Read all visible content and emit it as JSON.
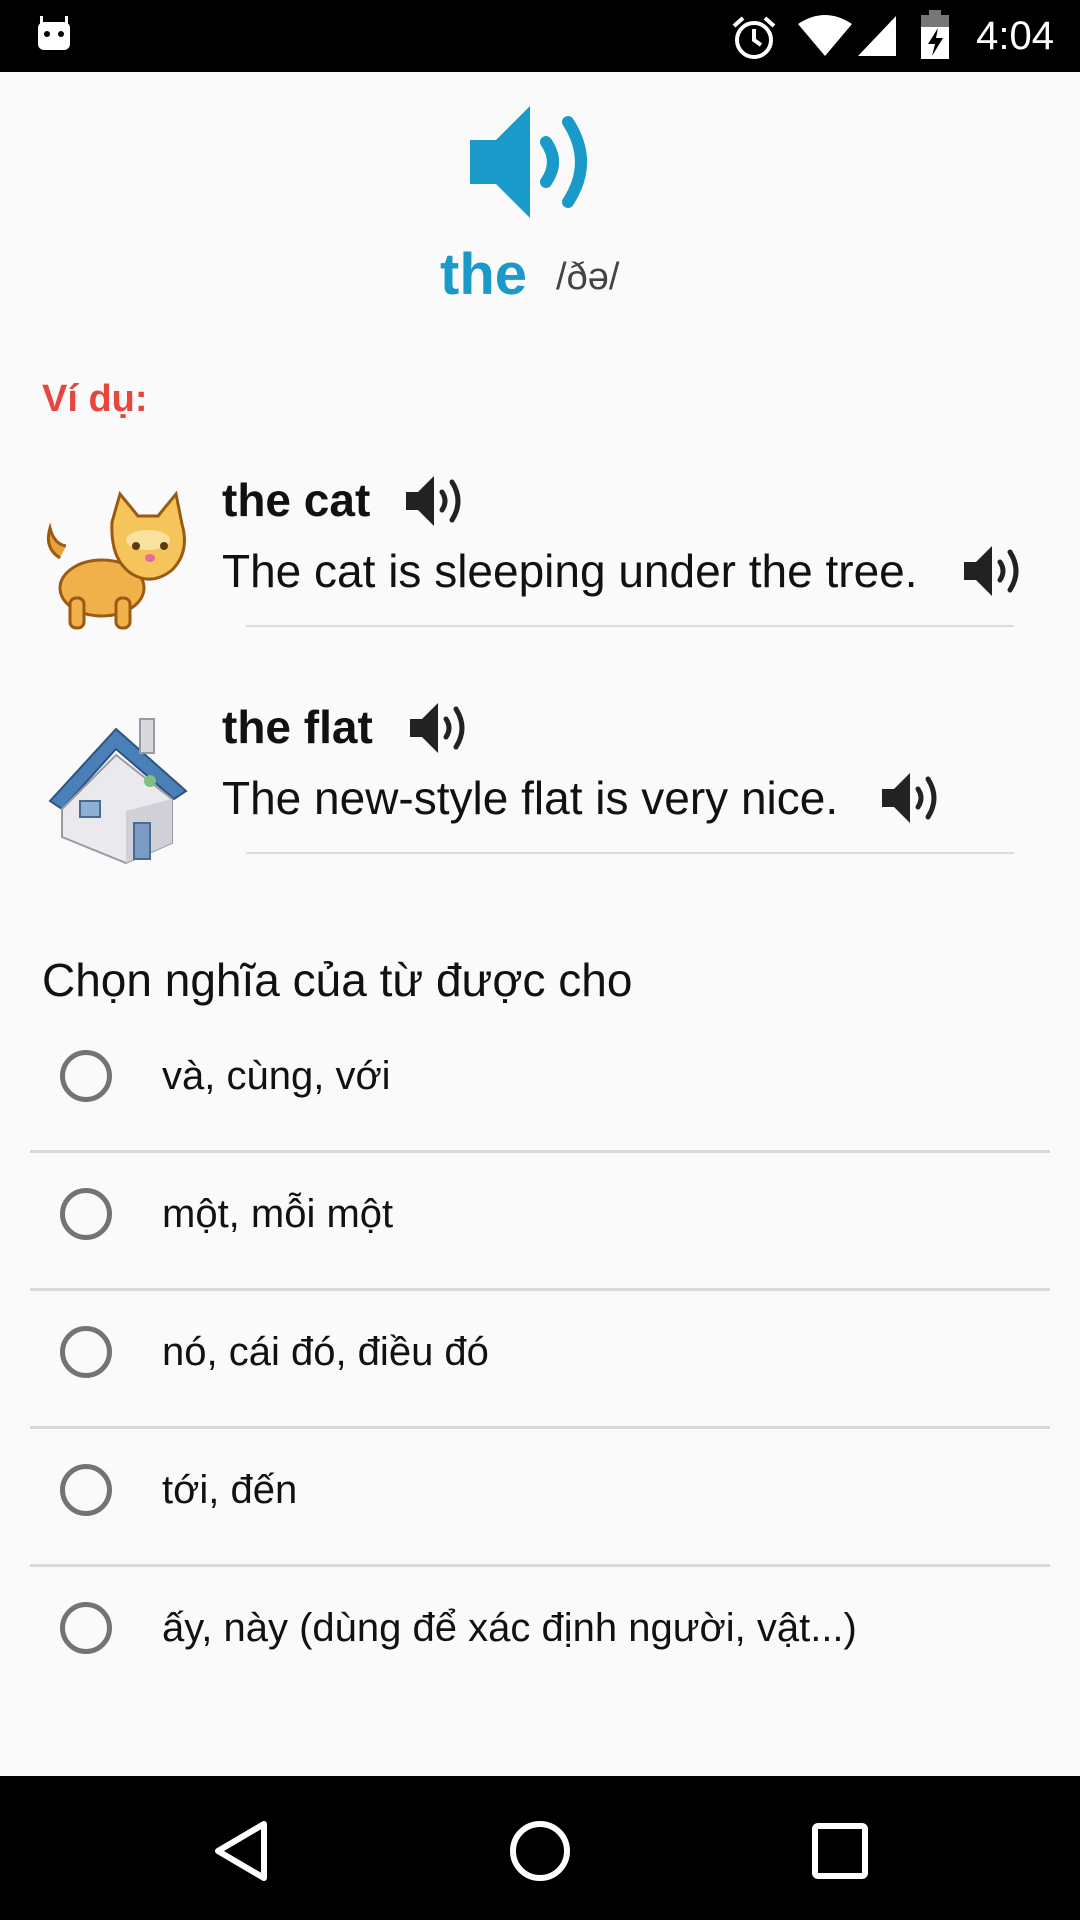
{
  "status_bar": {
    "time": "4:04",
    "icons": [
      "android-notification-icon",
      "alarm-icon",
      "wifi-icon",
      "cellular-signal-icon",
      "battery-charging-icon"
    ]
  },
  "header": {
    "word": "the",
    "phonetic": "/ðə/",
    "speaker_icon": "speaker-icon",
    "accent_color": "#1a9ac9"
  },
  "examples": {
    "label": "Ví dụ:",
    "label_color": "#e8463c",
    "items": [
      {
        "image": "cat-icon",
        "phrase": "the cat",
        "sentence": "The cat is sleeping under the tree."
      },
      {
        "image": "house-icon",
        "phrase": "the flat",
        "sentence": "The new-style flat is very nice."
      }
    ]
  },
  "quiz": {
    "question": "Chọn nghĩa của từ được cho",
    "options": [
      "và, cùng, với",
      "một, mỗi một",
      "nó, cái đó, điều đó",
      "tới, đến",
      "ấy, này (dùng để xác định người, vật...)"
    ]
  },
  "nav_bar": {
    "buttons": [
      "back-icon",
      "home-icon",
      "recents-icon"
    ]
  }
}
